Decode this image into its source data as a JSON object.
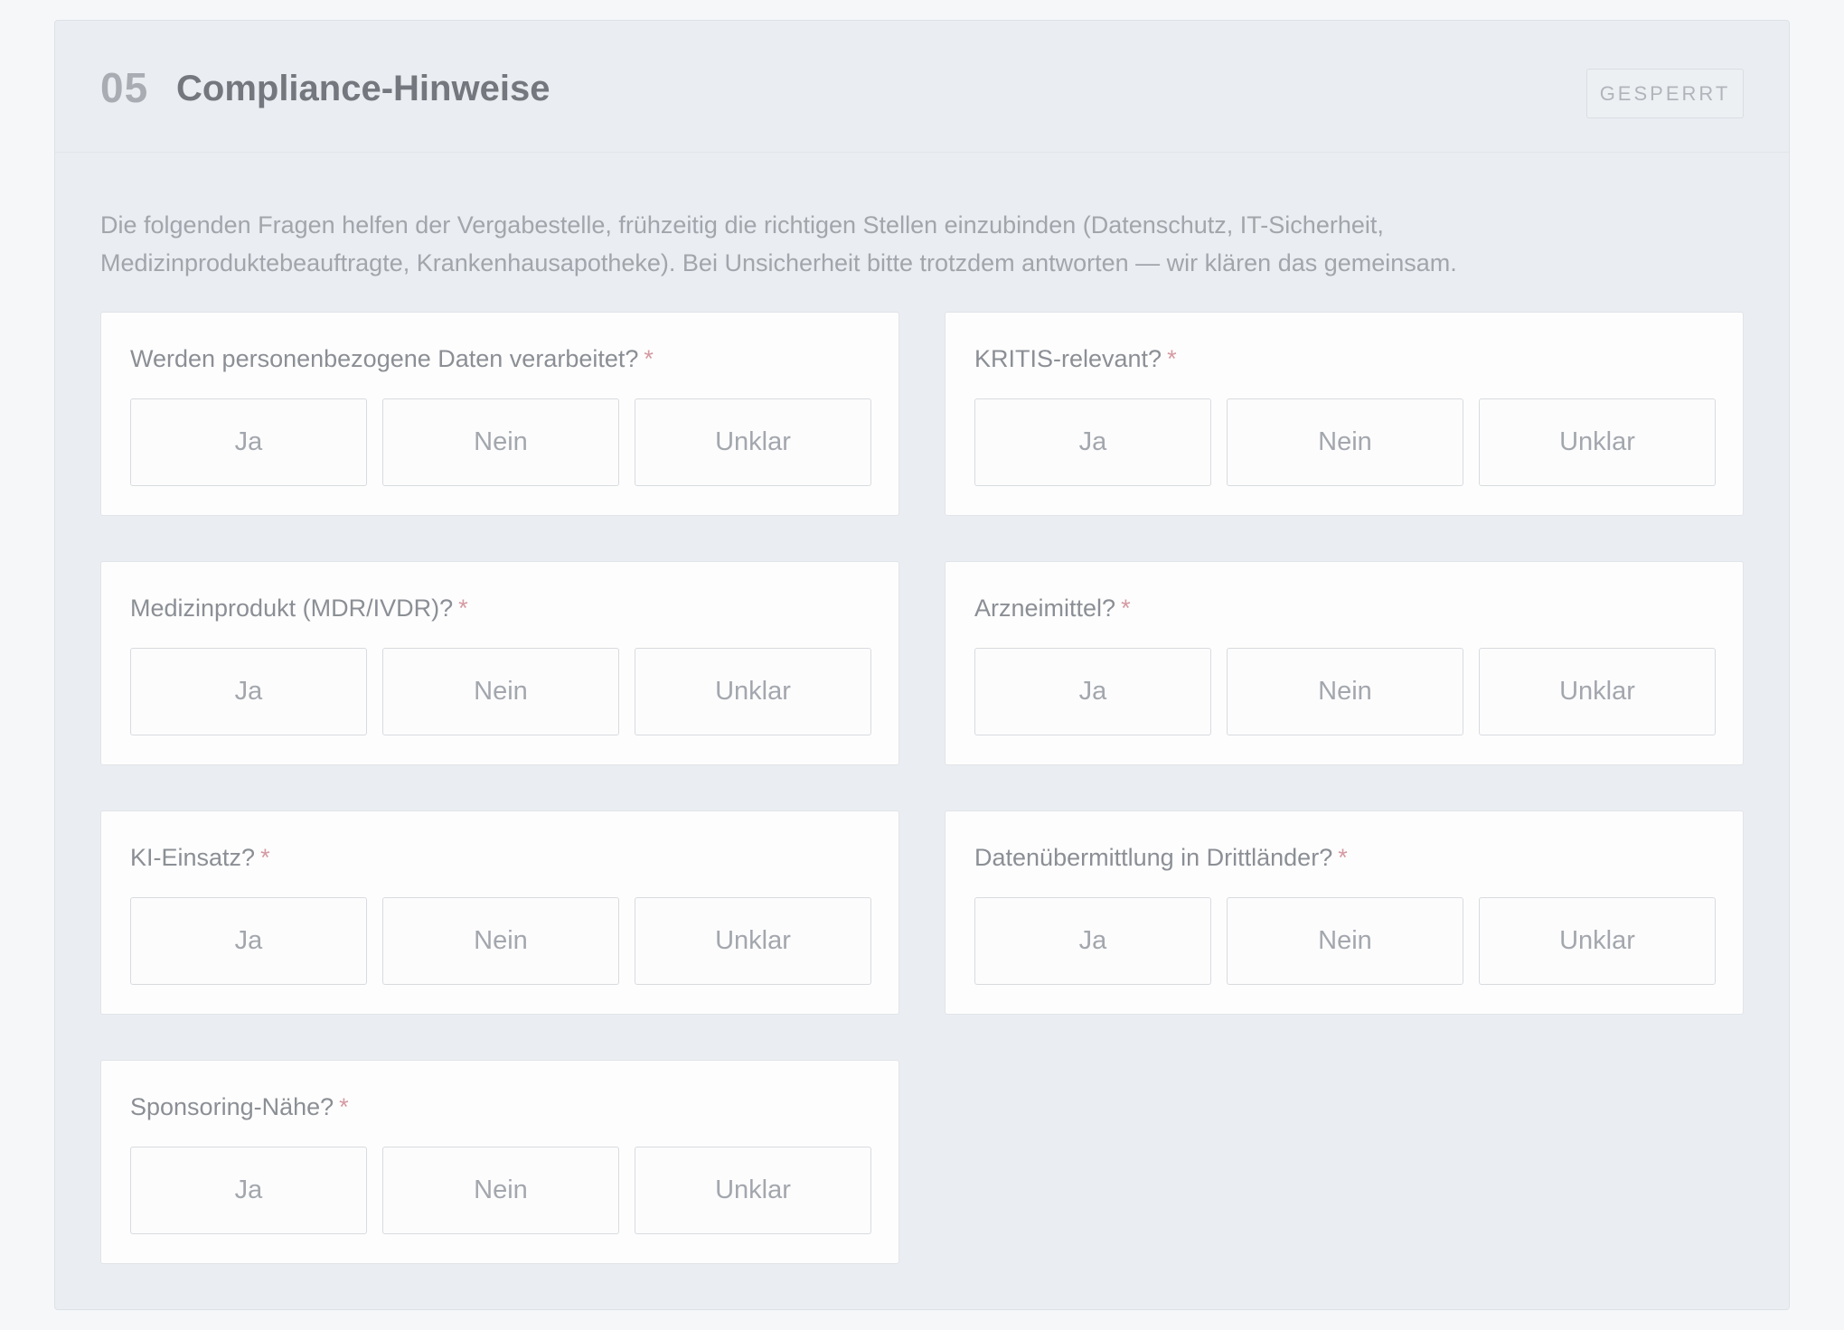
{
  "section": {
    "number": "05",
    "title": "Compliance-Hinweise",
    "status": "GESPERRT",
    "intro": "Die folgenden Fragen helfen der Vergabestelle, frühzeitig die richtigen Stellen einzubinden (Datenschutz, IT-Sicherheit, Medizinproduktebeauftragte, Krankenhausapotheke). Bei Unsicherheit bitte trotzdem antworten — wir klären das gemeinsam."
  },
  "required_marker": "*",
  "options": [
    "Ja",
    "Nein",
    "Unklar"
  ],
  "questions": [
    {
      "label": "Werden personenbezogene Daten verarbeitet?"
    },
    {
      "label": "KRITIS-relevant?"
    },
    {
      "label": "Medizinprodukt (MDR/IVDR)?"
    },
    {
      "label": "Arzneimittel?"
    },
    {
      "label": "KI-Einsatz?"
    },
    {
      "label": "Datenübermittlung in Drittländer?"
    },
    {
      "label": "Sponsoring-Nähe?"
    }
  ]
}
